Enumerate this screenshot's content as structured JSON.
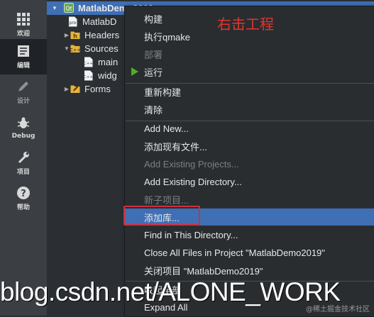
{
  "sidebar": {
    "items": [
      {
        "label": "欢迎",
        "icon": "grid-icon"
      },
      {
        "label": "编辑",
        "icon": "edit-document-icon"
      },
      {
        "label": "设计",
        "icon": "pencil-icon"
      },
      {
        "label": "Debug",
        "icon": "bug-icon"
      },
      {
        "label": "项目",
        "icon": "wrench-icon"
      },
      {
        "label": "帮助",
        "icon": "help-icon"
      }
    ]
  },
  "tree": {
    "project": "MatlabDemo2019",
    "items": [
      {
        "label": "MatlabD"
      },
      {
        "label": "Headers"
      },
      {
        "label": "Sources"
      },
      {
        "label": "main"
      },
      {
        "label": "widg"
      },
      {
        "label": "Forms"
      }
    ]
  },
  "menu": {
    "items": [
      {
        "label": "构建"
      },
      {
        "label": "执行qmake"
      },
      {
        "label": "部署"
      },
      {
        "label": "运行"
      },
      {
        "label": "重新构建"
      },
      {
        "label": "清除"
      },
      {
        "label": "Add New..."
      },
      {
        "label": "添加现有文件..."
      },
      {
        "label": "Add Existing Projects..."
      },
      {
        "label": "Add Existing Directory..."
      },
      {
        "label": "新子项目..."
      },
      {
        "label": "添加库..."
      },
      {
        "label": "Find in This Directory..."
      },
      {
        "label": "Close All Files in Project \"MatlabDemo2019\""
      },
      {
        "label": "关闭项目 \"MatlabDemo2019\""
      },
      {
        "label": "收起全部"
      },
      {
        "label": "Expand All"
      }
    ]
  },
  "annotation": "右击工程",
  "watermark": "blog.csdn.net/ALONE_WORK",
  "watermark_small": "@稀土掘金技术社区",
  "colors": {
    "highlight": "#3f6fb5",
    "run": "#4caf2a",
    "annotation": "#e3342f"
  }
}
